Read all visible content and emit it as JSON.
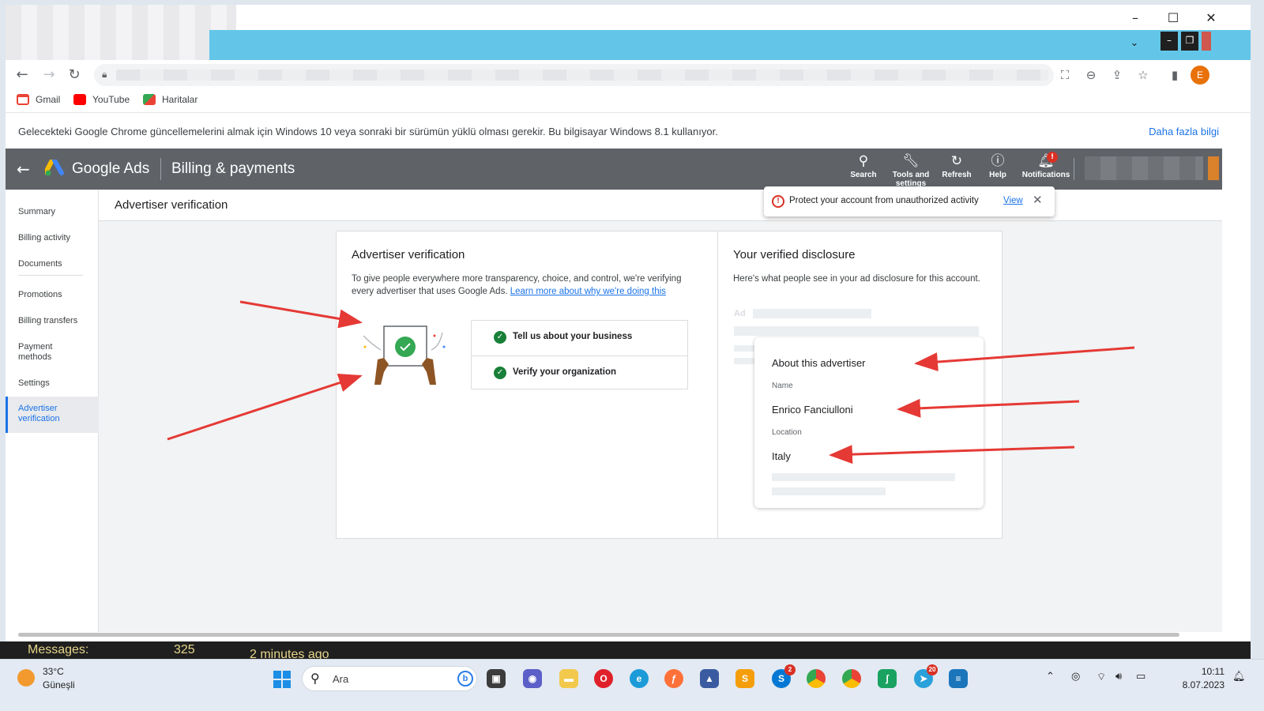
{
  "browser": {
    "infobar_text": "Gelecekteki Google Chrome güncellemelerini almak için Windows 10 veya sonraki bir sürümün yüklü olması gerekir. Bu bilgisayar Windows 8.1 kullanıyor.",
    "infobar_link": "Daha fazla bilgi",
    "profile_initial": "E",
    "bookmarks": [
      {
        "label": "Gmail",
        "icon": "gmail-icon",
        "color": "#ea4335"
      },
      {
        "label": "YouTube",
        "icon": "youtube-icon",
        "color": "#ff0000"
      },
      {
        "label": "Haritalar",
        "icon": "maps-icon",
        "color": "#34a853"
      }
    ]
  },
  "ads_header": {
    "brand": "Google Ads",
    "section": "Billing & payments",
    "buttons": [
      {
        "label": "Search",
        "icon": "search-icon"
      },
      {
        "label": "Tools and settings",
        "icon": "wrench-icon"
      },
      {
        "label": "Refresh",
        "icon": "refresh-icon"
      },
      {
        "label": "Help",
        "icon": "help-icon"
      },
      {
        "label": "Notifications",
        "icon": "bell-icon",
        "badge": "!"
      }
    ]
  },
  "sidenav": {
    "items": [
      "Summary",
      "Billing activity",
      "Documents",
      "Promotions",
      "Billing transfers",
      "Payment methods",
      "Settings",
      "Advertiser verification"
    ],
    "active": "Advertiser verification"
  },
  "page": {
    "title": "Advertiser verification",
    "toast": {
      "text": "Protect your account from unauthorized activity",
      "link": "View"
    }
  },
  "verification": {
    "title": "Advertiser verification",
    "description": "To give people everywhere more transparency, choice, and control, we're verifying every advertiser that uses Google Ads.",
    "link": "Learn more about why we're doing this",
    "steps": [
      "Tell us about your business",
      "Verify your organization"
    ]
  },
  "disclosure": {
    "title": "Your verified disclosure",
    "description": "Here's what people see in your ad disclosure for this account.",
    "ad_label": "Ad",
    "about_title": "About this advertiser",
    "name_label": "Name",
    "name_value": "Enrico Fanciulloni",
    "location_label": "Location",
    "location_value": "Italy"
  },
  "message_strip": {
    "label": "Messages:",
    "count": "325",
    "time": "2 minutes ago"
  },
  "taskbar": {
    "temperature": "33°C",
    "condition": "Güneşli",
    "search_placeholder": "Ara",
    "time": "10:11",
    "date": "8.07.2023",
    "badges": {
      "skype": "2",
      "telegram": "20"
    }
  }
}
